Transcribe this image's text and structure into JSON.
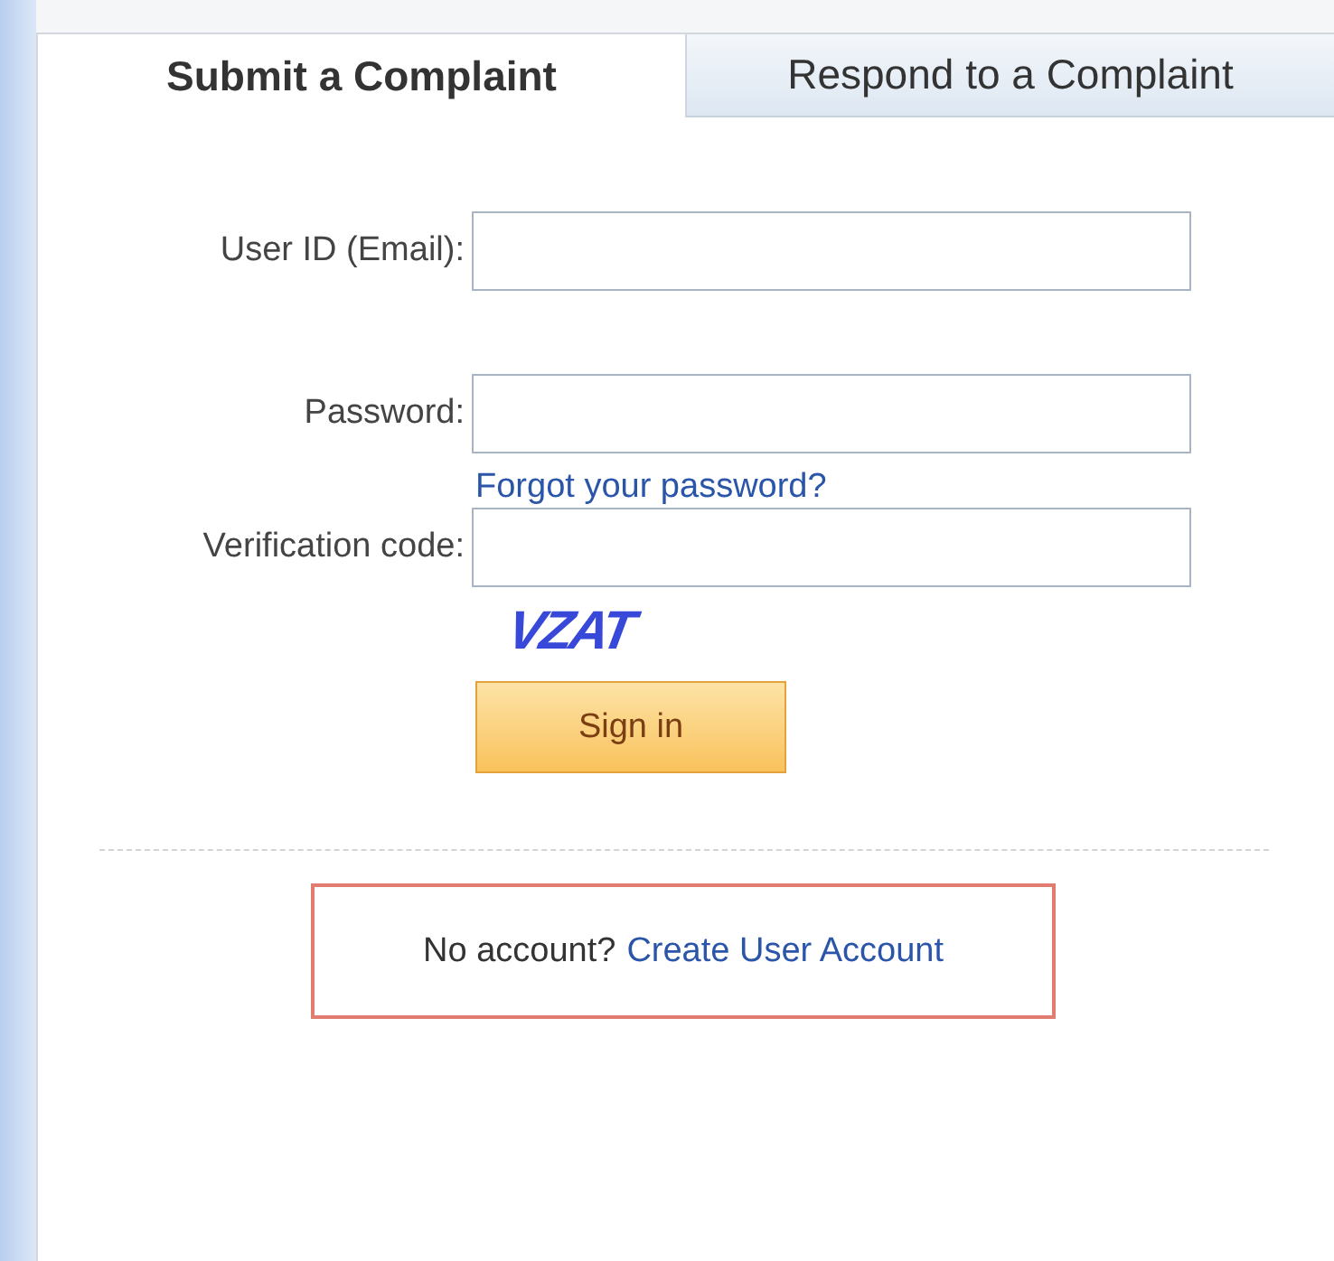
{
  "tabs": [
    {
      "label": "Submit a Complaint",
      "selected": true
    },
    {
      "label": "Respond to a Complaint",
      "selected": false
    }
  ],
  "fields": [
    {
      "label": "User ID (Email):"
    },
    {
      "label": "Password:",
      "link": "Forgot your password?"
    },
    {
      "label": "Verification code:"
    }
  ],
  "captcha": "VZAT",
  "sign_in": "Sign in",
  "account_box": {
    "text": "No account?",
    "link": "Create User Account"
  }
}
